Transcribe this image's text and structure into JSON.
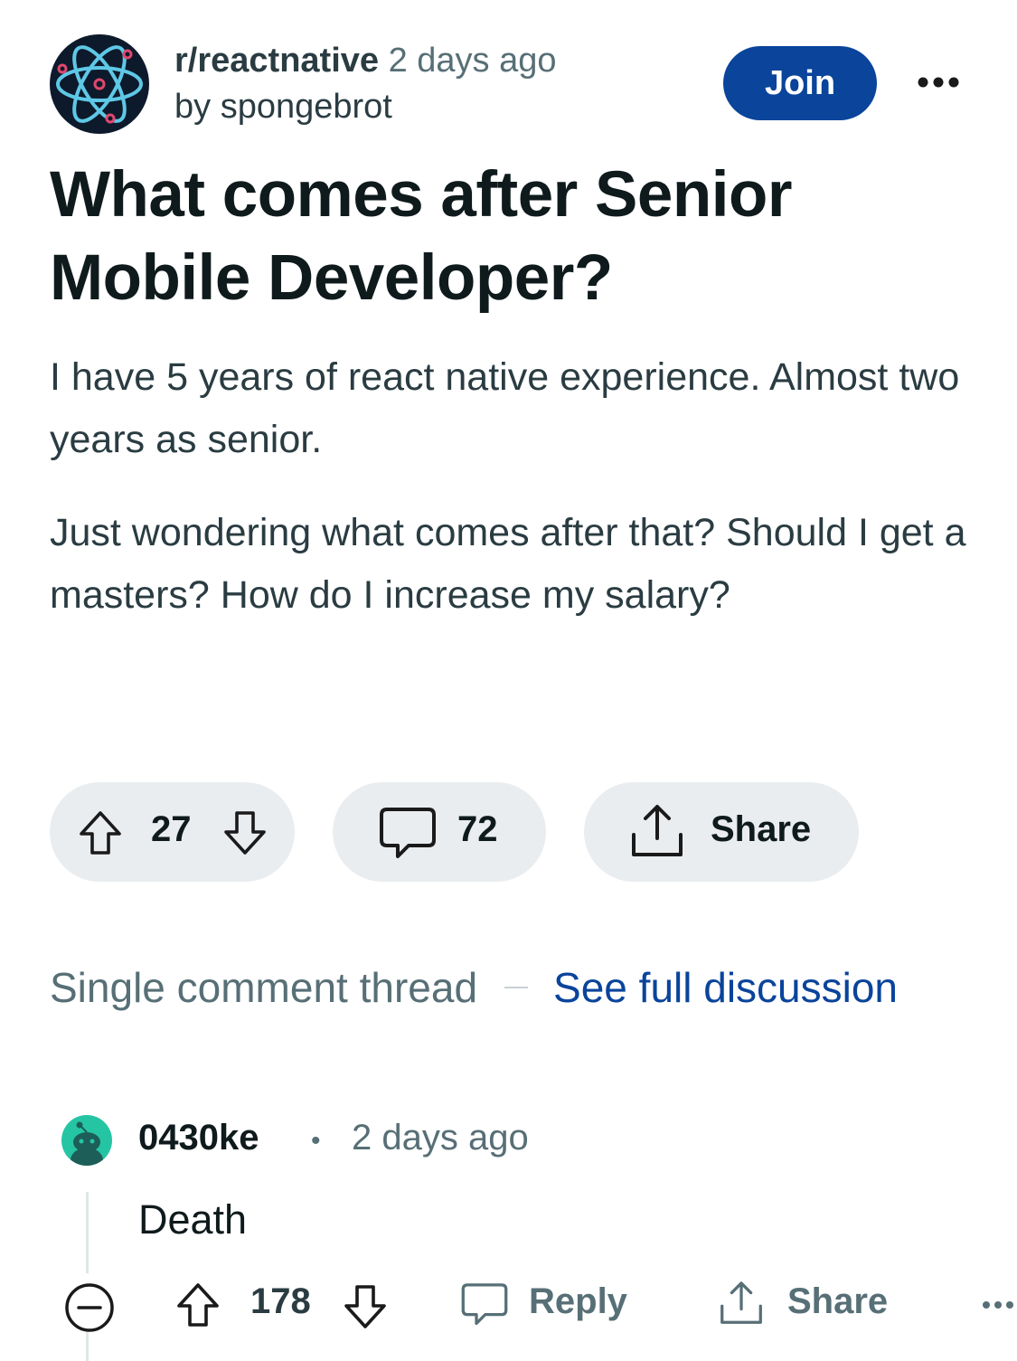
{
  "header": {
    "subreddit": "r/reactnative",
    "time": "2 days ago",
    "author": "by spongebrot",
    "join_label": "Join"
  },
  "post": {
    "title": "What comes after Senior Mobile Developer?",
    "body": [
      "I have 5 years of react native experience. Almost two years as senior.",
      "Just wondering what comes after that? Should I get a masters? How do I increase my salary?"
    ]
  },
  "actions": {
    "votes": "27",
    "comments": "72",
    "share_label": "Share"
  },
  "thread": {
    "label": "Single comment thread",
    "link": "See full discussion"
  },
  "comment": {
    "user": "0430ke",
    "separator": "•",
    "time": "2 days ago",
    "body": "Death",
    "votes": "178",
    "reply_label": "Reply",
    "share_label": "Share"
  },
  "colors": {
    "join_button": "#0a449b",
    "link": "#0a449b",
    "pill_background": "#eaedef",
    "comment_avatar": "#25c5a4",
    "sub_avatar": "#0d1a2b"
  },
  "icons": [
    "react-atom-logo",
    "more-horizontal-icon",
    "upvote-arrow-icon",
    "downvote-arrow-icon",
    "comment-bubble-icon",
    "share-icon",
    "collapse-minus-icon",
    "snoo-avatar"
  ]
}
